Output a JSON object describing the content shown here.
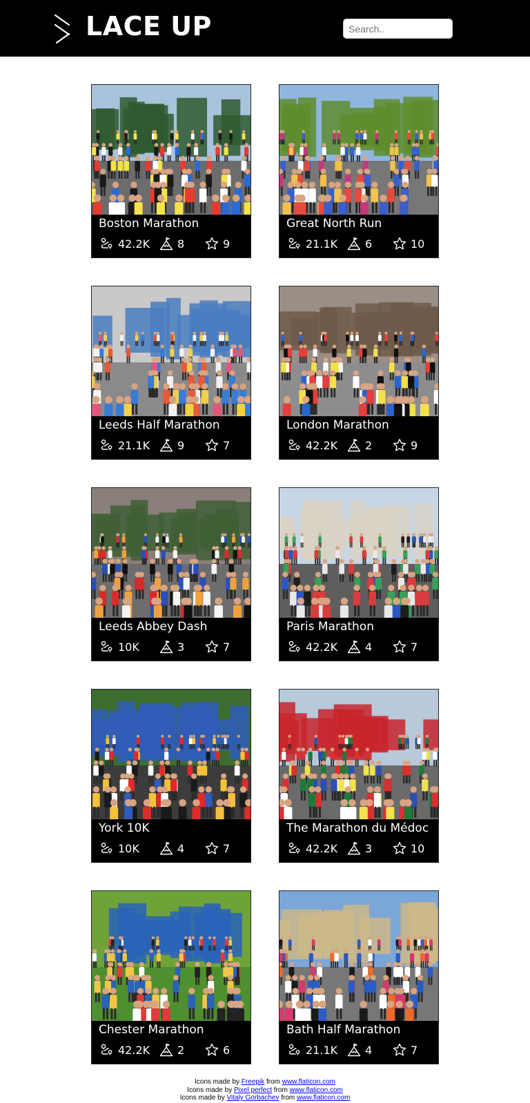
{
  "header": {
    "brand": "LACE UP",
    "search_placeholder": "Search.."
  },
  "icons": {
    "menu": "menu-icon",
    "distance": "route-icon",
    "difficulty": "mountain-flag-icon",
    "rating": "star-icon"
  },
  "races": [
    {
      "name": "Boston Marathon",
      "distance": "42.2K",
      "difficulty": "8",
      "rating": "9",
      "photo": {
        "sky": "#a9c3dc",
        "ground": "#6c6c6c",
        "accent": "#2f5a2f",
        "crowd": [
          "#e63c2f",
          "#f4e24a",
          "#2c6ad6",
          "#ffffff",
          "#1a1a1a"
        ]
      }
    },
    {
      "name": "Great North Run",
      "distance": "21.1K",
      "difficulty": "6",
      "rating": "10",
      "photo": {
        "sky": "#8fb6de",
        "ground": "#777777",
        "accent": "#5f8d2e",
        "crowd": [
          "#c23a7a",
          "#3b5fc9",
          "#e44b3c",
          "#ffffff",
          "#f2c14e"
        ]
      }
    },
    {
      "name": "Leeds Half Marathon",
      "distance": "21.1K",
      "difficulty": "9",
      "rating": "7",
      "photo": {
        "sky": "#c9c9c9",
        "ground": "#8a8a8a",
        "accent": "#4a7ec0",
        "crowd": [
          "#f2f2f2",
          "#e2577a",
          "#3a7bd5",
          "#f0d04a",
          "#e65a3a"
        ]
      }
    },
    {
      "name": "London Marathon",
      "distance": "42.2K",
      "difficulty": "2",
      "rating": "9",
      "photo": {
        "sky": "#9a8e86",
        "ground": "#8d8d8d",
        "accent": "#6d5a4a",
        "crowd": [
          "#2a66c9",
          "#f3e04b",
          "#101010",
          "#e83d3d",
          "#ffffff"
        ]
      }
    },
    {
      "name": "Leeds Abbey Dash",
      "distance": "10K",
      "difficulty": "3",
      "rating": "7",
      "photo": {
        "sky": "#8a7f7a",
        "ground": "#6d6d6d",
        "accent": "#3f5f37",
        "crowd": [
          "#d62b2b",
          "#2b4fb8",
          "#f4f4f4",
          "#f0a23a",
          "#111111"
        ]
      }
    },
    {
      "name": "Paris Marathon",
      "distance": "42.2K",
      "difficulty": "4",
      "rating": "7",
      "photo": {
        "sky": "#c6d6e6",
        "ground": "#5e5e5e",
        "accent": "#d8d2c4",
        "crowd": [
          "#2e55c4",
          "#e8e8e8",
          "#d83c3c",
          "#38a05a",
          "#1d1d1d"
        ]
      }
    },
    {
      "name": "York 10K",
      "distance": "10K",
      "difficulty": "4",
      "rating": "7",
      "photo": {
        "sky": "#3d6d2e",
        "ground": "#3c3c3c",
        "accent": "#2f5db8",
        "crowd": [
          "#e02a2a",
          "#ffffff",
          "#2f5db8",
          "#f3c13a",
          "#1a1a1a"
        ]
      }
    },
    {
      "name": "The Marathon du Médoc",
      "distance": "42.2K",
      "difficulty": "3",
      "rating": "10",
      "photo": {
        "sky": "#b7c9da",
        "ground": "#6a6a6a",
        "accent": "#c8252b",
        "crowd": [
          "#2f4fb0",
          "#f0e34c",
          "#d93030",
          "#ffffff",
          "#1f7a3a"
        ]
      }
    },
    {
      "name": "Chester Marathon",
      "distance": "42.2K",
      "difficulty": "2",
      "rating": "6",
      "photo": {
        "sky": "#6fa33a",
        "ground": "#4f8f2f",
        "accent": "#2a63b8",
        "crowd": [
          "#ffffff",
          "#e03a3a",
          "#2a63b8",
          "#f0c64a",
          "#222222"
        ]
      }
    },
    {
      "name": "Bath Half Marathon",
      "distance": "21.1K",
      "difficulty": "4",
      "rating": "7",
      "photo": {
        "sky": "#7aa6d8",
        "ground": "#777777",
        "accent": "#cdb88a",
        "crowd": [
          "#ee6a2a",
          "#ffffff",
          "#2b5cc4",
          "#d63a6a",
          "#1a1a1a"
        ]
      }
    }
  ],
  "credits": [
    {
      "prefix": "Icons made by ",
      "author": "Freepik",
      "middle": " from ",
      "site": "www.flaticon.com"
    },
    {
      "prefix": "Icons made by ",
      "author": "Pixel perfect",
      "middle": " from ",
      "site": "www.flaticon.com"
    },
    {
      "prefix": "Icons made by ",
      "author": "Vitaly Gorbachev",
      "middle": " from ",
      "site": "www.flaticon.com"
    }
  ]
}
